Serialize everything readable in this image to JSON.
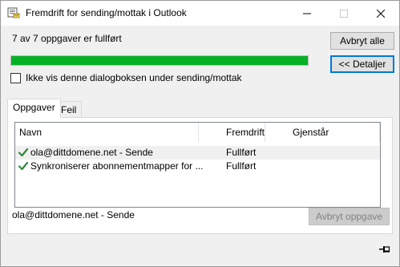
{
  "window": {
    "title": "Fremdrift for sending/mottak i Outlook"
  },
  "status": {
    "text": "7 av 7 oppgaver er fullført",
    "progress_fraction": 1.0
  },
  "buttons": {
    "cancel_all": "Avbryt alle",
    "details": "<< Detaljer",
    "cancel_task": "Avbryt oppgave"
  },
  "checkbox": {
    "label": "Ikke vis denne dialogboksen under sending/mottak",
    "checked": false
  },
  "tabs": [
    {
      "label": "Oppgaver",
      "active": true
    },
    {
      "label": "Feil",
      "active": false
    }
  ],
  "list": {
    "columns": [
      "Navn",
      "Fremdrift",
      "Gjenstår"
    ],
    "rows": [
      {
        "name": "ola@dittdomene.net - Sende",
        "progress": "Fullført",
        "remaining": ""
      },
      {
        "name": "Synkroniserer abonnementmapper for ...",
        "progress": "Fullført",
        "remaining": ""
      }
    ]
  },
  "current_task": "ola@dittdomene.net - Sende",
  "icons": {
    "app": "outlook-send-receive-icon",
    "row_status": "checkmark-icon",
    "pin": "pin-icon"
  },
  "colors": {
    "progress": "#06b025",
    "check": "#2e8b3a"
  }
}
